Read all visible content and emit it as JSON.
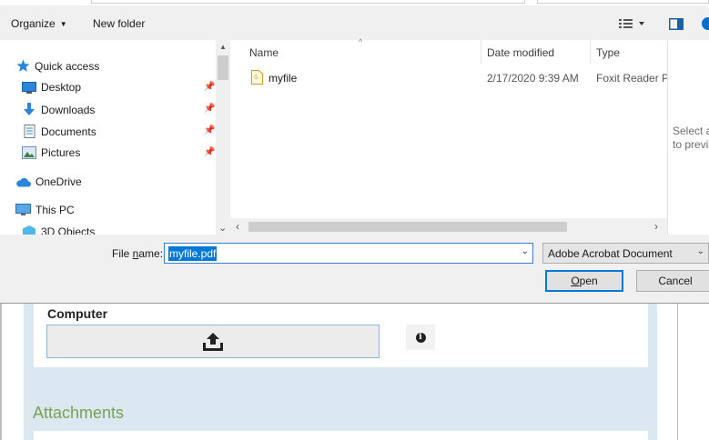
{
  "toolbar": {
    "organize_label": "Organize",
    "new_folder_label": "New folder"
  },
  "nav": {
    "items": [
      {
        "label": "Quick access",
        "icon": "star-icon"
      },
      {
        "label": "Desktop",
        "icon": "desktop-folder-icon"
      },
      {
        "label": "Downloads",
        "icon": "download-arrow-icon"
      },
      {
        "label": "Documents",
        "icon": "documents-icon"
      },
      {
        "label": "Pictures",
        "icon": "pictures-icon"
      },
      {
        "label": "OneDrive",
        "icon": "cloud-icon"
      },
      {
        "label": "This PC",
        "icon": "monitor-icon"
      },
      {
        "label": "3D Objects",
        "icon": "cube-icon"
      }
    ]
  },
  "columns": {
    "name": "Name",
    "date_modified": "Date modified",
    "type": "Type"
  },
  "files": [
    {
      "name": "myfile",
      "date": "2/17/2020 9:39 AM",
      "type": "Foxit Reader PDF Document",
      "icon": "pdf-file-icon"
    }
  ],
  "preview": {
    "line1": "Select a file",
    "line2": "to preview."
  },
  "filename": {
    "label_prefix": "File ",
    "label_accel": "n",
    "label_suffix": "ame:",
    "value": "myfile.pdf"
  },
  "filetype": {
    "selected": "Adobe Acrobat Document"
  },
  "buttons": {
    "open_accel": "O",
    "open_rest": "pen",
    "cancel": "Cancel"
  },
  "webpage": {
    "section_title": "Computer",
    "attachments_title": "Attachments",
    "upload_icon": "upload-icon",
    "info_icon": "info-icon"
  },
  "colors": {
    "accent": "#0078d7",
    "attachments_green": "#7aa04f",
    "panel_blue": "#dbe8f2"
  }
}
